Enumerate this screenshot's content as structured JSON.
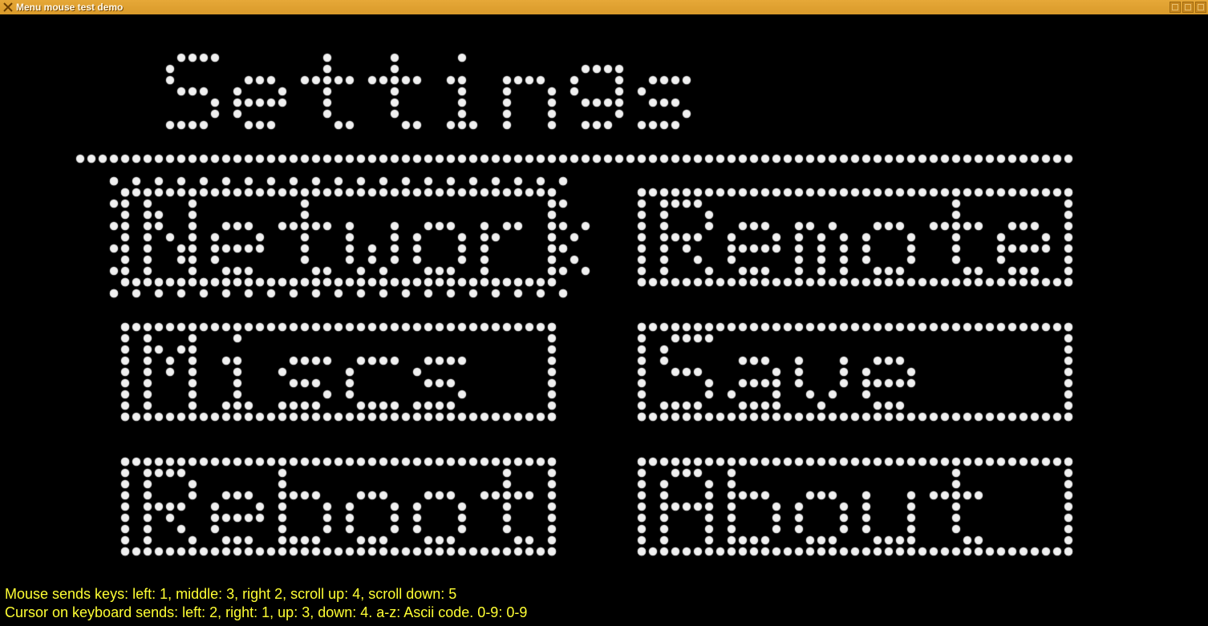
{
  "window": {
    "icon_name": "app-x-icon",
    "title": "Menu mouse test demo"
  },
  "heading": "Settings",
  "menu": {
    "items": [
      {
        "label": "Network",
        "selected": true
      },
      {
        "label": "Remote",
        "selected": false
      },
      {
        "label": "Miscs",
        "selected": false
      },
      {
        "label": "Save",
        "selected": false
      },
      {
        "label": "Reboot",
        "selected": false
      },
      {
        "label": "About",
        "selected": false
      }
    ]
  },
  "status": {
    "line1": "Mouse sends keys: left: 1, middle: 3, right 2, scroll up: 4, scroll down: 5",
    "line2": "Cursor on keyboard sends: left: 2, right: 1, up: 3, down: 4. a-z: Ascii code. 0-9: 0-9"
  },
  "led": {
    "dot_color": "#f0f0f0"
  }
}
